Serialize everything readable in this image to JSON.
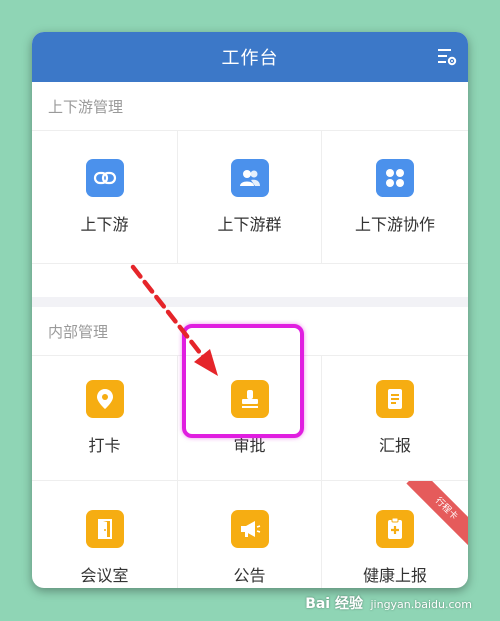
{
  "app": {
    "title": "工作台"
  },
  "sections": [
    {
      "title": "上下游管理",
      "items": [
        {
          "label": "上下游",
          "icon": "link-icon",
          "color": "#4b91ec"
        },
        {
          "label": "上下游群",
          "icon": "group-icon",
          "color": "#4b91ec"
        },
        {
          "label": "上下游协作",
          "icon": "grid-icon",
          "color": "#4b91ec"
        }
      ]
    },
    {
      "title": "内部管理",
      "items": [
        {
          "label": "打卡",
          "icon": "location-pin-icon",
          "color": "#f6ad12"
        },
        {
          "label": "审批",
          "icon": "stamp-icon",
          "color": "#f6ad12"
        },
        {
          "label": "汇报",
          "icon": "report-icon",
          "color": "#f6ad12"
        },
        {
          "label": "会议室",
          "icon": "door-icon",
          "color": "#f6ad12"
        },
        {
          "label": "公告",
          "icon": "megaphone-icon",
          "color": "#f6ad12"
        },
        {
          "label": "健康上报",
          "icon": "health-report-icon",
          "color": "#f6ad12",
          "badge": "行程卡"
        }
      ]
    }
  ],
  "watermark": {
    "brand": "Bai 经验",
    "url": "jingyan.baidu.com"
  },
  "colors": {
    "header": "#3c78c8",
    "highlight": "#e01ee0",
    "arrow": "#e5252a",
    "background": "#8fd5b5"
  }
}
